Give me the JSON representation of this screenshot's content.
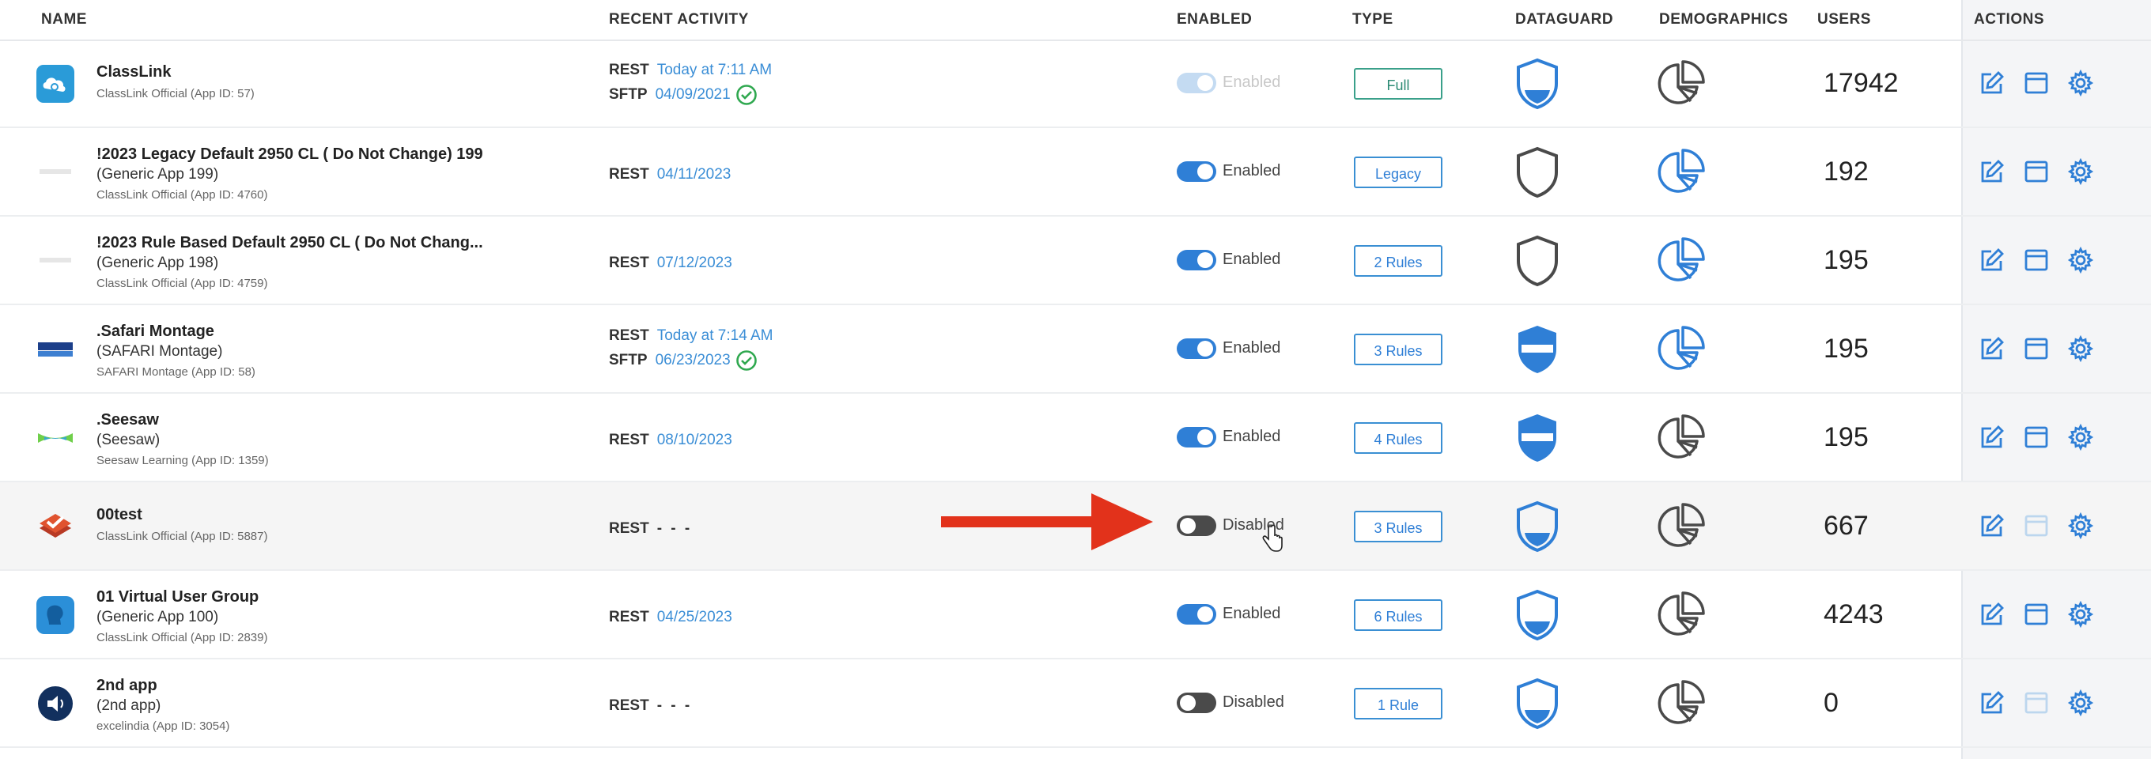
{
  "headers": {
    "name": "NAME",
    "recent_activity": "RECENT ACTIVITY",
    "enabled": "ENABLED",
    "type": "TYPE",
    "dataguard": "DATAGUARD",
    "demographics": "DEMOGRAPHICS",
    "users": "USERS",
    "actions": "ACTIONS"
  },
  "colors": {
    "accent": "#2f7fd6",
    "link": "#3b8ed6",
    "success": "#2fa84f",
    "annotation_arrow": "#e2321b"
  },
  "rows": [
    {
      "name": "ClassLink",
      "sub": "",
      "meta": "ClassLink Official (App ID: 57)",
      "icon": "classlink-logo-icon",
      "activity": [
        {
          "proto": "REST",
          "value": "Today at 7:11 AM",
          "check": false
        },
        {
          "proto": "SFTP",
          "value": "04/09/2021",
          "check": true
        }
      ],
      "enabled_label": "Enabled",
      "enabled_state": "on-faded",
      "type": "Full",
      "dataguard": "shield-half-filled-icon",
      "demographics": "pie-chart-gray-icon",
      "users": "17942",
      "settings_disabled": false
    },
    {
      "name": "!2023 Legacy Default 2950 CL ( Do Not Change) 199",
      "sub": "(Generic App 199)",
      "meta": "ClassLink Official (App ID: 4760)",
      "icon": "placeholder-logo-icon",
      "activity": [
        {
          "proto": "REST",
          "value": "04/11/2023",
          "check": false
        }
      ],
      "enabled_label": "Enabled",
      "enabled_state": "on",
      "type": "Legacy",
      "dataguard": "shield-outline-icon",
      "demographics": "pie-chart-blue-icon",
      "users": "192",
      "settings_disabled": false
    },
    {
      "name": "!2023 Rule Based Default 2950 CL ( Do Not Chang...",
      "sub": "(Generic App 198)",
      "meta": "ClassLink Official (App ID: 4759)",
      "icon": "placeholder-logo-icon",
      "activity": [
        {
          "proto": "REST",
          "value": "07/12/2023",
          "check": false
        }
      ],
      "enabled_label": "Enabled",
      "enabled_state": "on",
      "type": "2 Rules",
      "dataguard": "shield-outline-icon",
      "demographics": "pie-chart-blue-icon",
      "users": "195",
      "settings_disabled": false
    },
    {
      "name": ".Safari Montage",
      "sub": "(SAFARI Montage)",
      "meta": "SAFARI Montage (App ID: 58)",
      "icon": "safari-montage-logo-icon",
      "activity": [
        {
          "proto": "REST",
          "value": "Today at 7:14 AM",
          "check": false
        },
        {
          "proto": "SFTP",
          "value": "06/23/2023",
          "check": true
        }
      ],
      "enabled_label": "Enabled",
      "enabled_state": "on",
      "type": "3 Rules",
      "dataguard": "shield-striped-icon",
      "demographics": "pie-chart-blue-icon",
      "users": "195",
      "settings_disabled": false
    },
    {
      "name": ".Seesaw",
      "sub": "(Seesaw)",
      "meta": "Seesaw Learning (App ID: 1359)",
      "icon": "seesaw-logo-icon",
      "activity": [
        {
          "proto": "REST",
          "value": "08/10/2023",
          "check": false
        }
      ],
      "enabled_label": "Enabled",
      "enabled_state": "on",
      "type": "4 Rules",
      "dataguard": "shield-striped-icon",
      "demographics": "pie-chart-gray-icon",
      "users": "195",
      "settings_disabled": false
    },
    {
      "name": "00test",
      "sub": "",
      "meta": "ClassLink Official (App ID: 5887)",
      "icon": "checkmark-box-logo-icon",
      "activity": [
        {
          "proto": "REST",
          "value": "- - -",
          "check": false
        }
      ],
      "enabled_label": "Disabled",
      "enabled_state": "off",
      "type": "3 Rules",
      "dataguard": "shield-half-filled-icon",
      "demographics": "pie-chart-gray-icon",
      "users": "667",
      "settings_disabled": true
    },
    {
      "name": "01 Virtual User Group",
      "sub": "(Generic App 100)",
      "meta": "ClassLink Official (App ID: 2839)",
      "icon": "head-profile-logo-icon",
      "activity": [
        {
          "proto": "REST",
          "value": "04/25/2023",
          "check": false
        }
      ],
      "enabled_label": "Enabled",
      "enabled_state": "on",
      "type": "6 Rules",
      "dataguard": "shield-half-filled-icon",
      "demographics": "pie-chart-gray-icon",
      "users": "4243",
      "settings_disabled": false
    },
    {
      "name": "2nd app",
      "sub": "(2nd app)",
      "meta": "excelindia (App ID: 3054)",
      "icon": "speaker-logo-icon",
      "activity": [
        {
          "proto": "REST",
          "value": "- - -",
          "check": false
        }
      ],
      "enabled_label": "Disabled",
      "enabled_state": "off",
      "type": "1 Rule",
      "dataguard": "shield-half-filled-icon",
      "demographics": "pie-chart-gray-icon",
      "users": "0",
      "settings_disabled": true
    }
  ]
}
